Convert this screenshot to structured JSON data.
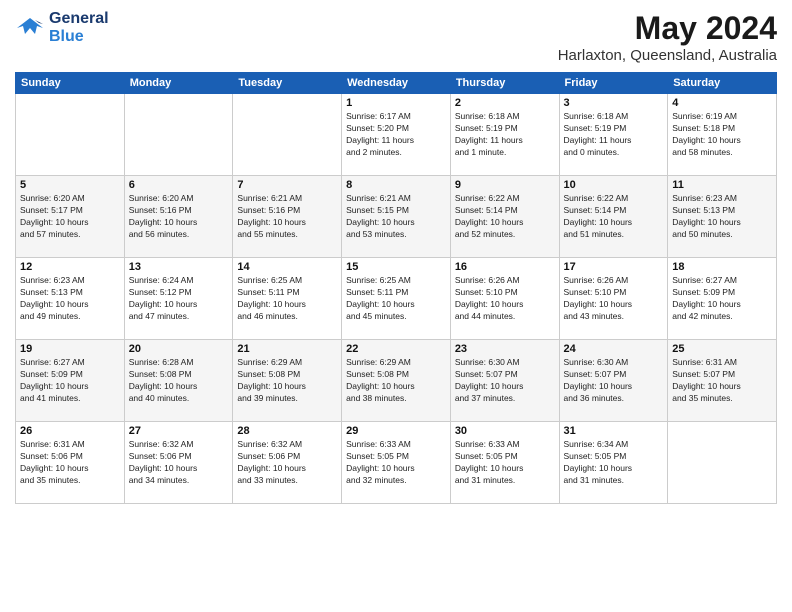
{
  "header": {
    "logo_line1": "General",
    "logo_line2": "Blue",
    "month": "May 2024",
    "location": "Harlaxton, Queensland, Australia"
  },
  "weekdays": [
    "Sunday",
    "Monday",
    "Tuesday",
    "Wednesday",
    "Thursday",
    "Friday",
    "Saturday"
  ],
  "weeks": [
    [
      {
        "day": "",
        "info": ""
      },
      {
        "day": "",
        "info": ""
      },
      {
        "day": "",
        "info": ""
      },
      {
        "day": "1",
        "info": "Sunrise: 6:17 AM\nSunset: 5:20 PM\nDaylight: 11 hours\nand 2 minutes."
      },
      {
        "day": "2",
        "info": "Sunrise: 6:18 AM\nSunset: 5:19 PM\nDaylight: 11 hours\nand 1 minute."
      },
      {
        "day": "3",
        "info": "Sunrise: 6:18 AM\nSunset: 5:19 PM\nDaylight: 11 hours\nand 0 minutes."
      },
      {
        "day": "4",
        "info": "Sunrise: 6:19 AM\nSunset: 5:18 PM\nDaylight: 10 hours\nand 58 minutes."
      }
    ],
    [
      {
        "day": "5",
        "info": "Sunrise: 6:20 AM\nSunset: 5:17 PM\nDaylight: 10 hours\nand 57 minutes."
      },
      {
        "day": "6",
        "info": "Sunrise: 6:20 AM\nSunset: 5:16 PM\nDaylight: 10 hours\nand 56 minutes."
      },
      {
        "day": "7",
        "info": "Sunrise: 6:21 AM\nSunset: 5:16 PM\nDaylight: 10 hours\nand 55 minutes."
      },
      {
        "day": "8",
        "info": "Sunrise: 6:21 AM\nSunset: 5:15 PM\nDaylight: 10 hours\nand 53 minutes."
      },
      {
        "day": "9",
        "info": "Sunrise: 6:22 AM\nSunset: 5:14 PM\nDaylight: 10 hours\nand 52 minutes."
      },
      {
        "day": "10",
        "info": "Sunrise: 6:22 AM\nSunset: 5:14 PM\nDaylight: 10 hours\nand 51 minutes."
      },
      {
        "day": "11",
        "info": "Sunrise: 6:23 AM\nSunset: 5:13 PM\nDaylight: 10 hours\nand 50 minutes."
      }
    ],
    [
      {
        "day": "12",
        "info": "Sunrise: 6:23 AM\nSunset: 5:13 PM\nDaylight: 10 hours\nand 49 minutes."
      },
      {
        "day": "13",
        "info": "Sunrise: 6:24 AM\nSunset: 5:12 PM\nDaylight: 10 hours\nand 47 minutes."
      },
      {
        "day": "14",
        "info": "Sunrise: 6:25 AM\nSunset: 5:11 PM\nDaylight: 10 hours\nand 46 minutes."
      },
      {
        "day": "15",
        "info": "Sunrise: 6:25 AM\nSunset: 5:11 PM\nDaylight: 10 hours\nand 45 minutes."
      },
      {
        "day": "16",
        "info": "Sunrise: 6:26 AM\nSunset: 5:10 PM\nDaylight: 10 hours\nand 44 minutes."
      },
      {
        "day": "17",
        "info": "Sunrise: 6:26 AM\nSunset: 5:10 PM\nDaylight: 10 hours\nand 43 minutes."
      },
      {
        "day": "18",
        "info": "Sunrise: 6:27 AM\nSunset: 5:09 PM\nDaylight: 10 hours\nand 42 minutes."
      }
    ],
    [
      {
        "day": "19",
        "info": "Sunrise: 6:27 AM\nSunset: 5:09 PM\nDaylight: 10 hours\nand 41 minutes."
      },
      {
        "day": "20",
        "info": "Sunrise: 6:28 AM\nSunset: 5:08 PM\nDaylight: 10 hours\nand 40 minutes."
      },
      {
        "day": "21",
        "info": "Sunrise: 6:29 AM\nSunset: 5:08 PM\nDaylight: 10 hours\nand 39 minutes."
      },
      {
        "day": "22",
        "info": "Sunrise: 6:29 AM\nSunset: 5:08 PM\nDaylight: 10 hours\nand 38 minutes."
      },
      {
        "day": "23",
        "info": "Sunrise: 6:30 AM\nSunset: 5:07 PM\nDaylight: 10 hours\nand 37 minutes."
      },
      {
        "day": "24",
        "info": "Sunrise: 6:30 AM\nSunset: 5:07 PM\nDaylight: 10 hours\nand 36 minutes."
      },
      {
        "day": "25",
        "info": "Sunrise: 6:31 AM\nSunset: 5:07 PM\nDaylight: 10 hours\nand 35 minutes."
      }
    ],
    [
      {
        "day": "26",
        "info": "Sunrise: 6:31 AM\nSunset: 5:06 PM\nDaylight: 10 hours\nand 35 minutes."
      },
      {
        "day": "27",
        "info": "Sunrise: 6:32 AM\nSunset: 5:06 PM\nDaylight: 10 hours\nand 34 minutes."
      },
      {
        "day": "28",
        "info": "Sunrise: 6:32 AM\nSunset: 5:06 PM\nDaylight: 10 hours\nand 33 minutes."
      },
      {
        "day": "29",
        "info": "Sunrise: 6:33 AM\nSunset: 5:05 PM\nDaylight: 10 hours\nand 32 minutes."
      },
      {
        "day": "30",
        "info": "Sunrise: 6:33 AM\nSunset: 5:05 PM\nDaylight: 10 hours\nand 31 minutes."
      },
      {
        "day": "31",
        "info": "Sunrise: 6:34 AM\nSunset: 5:05 PM\nDaylight: 10 hours\nand 31 minutes."
      },
      {
        "day": "",
        "info": ""
      }
    ]
  ]
}
